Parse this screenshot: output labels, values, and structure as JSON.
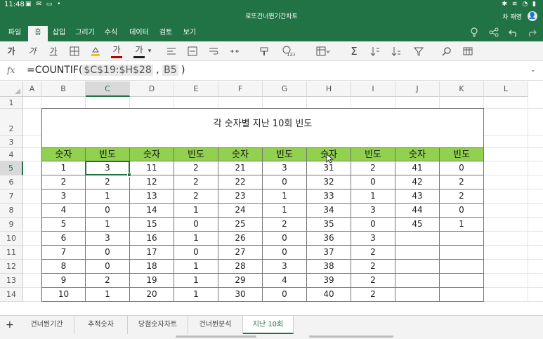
{
  "status": {
    "time": "11:48",
    "icons": "▣ ✉ ▭ •",
    "right": "✱ ≋ ◔ ▮"
  },
  "window": {
    "title": "로또건너뛴기간차트"
  },
  "user": {
    "name": "차 재영",
    "avatar": "👤"
  },
  "ribbon": {
    "tabs": [
      "파일",
      "홈",
      "삽입",
      "그리기",
      "수식",
      "데이터",
      "검토",
      "보기"
    ],
    "active_tab": "홈",
    "right_icons": [
      "lightbulb-icon",
      "share-icon",
      "undo-icon",
      "redo-icon"
    ]
  },
  "toolbar": {
    "bold": "가",
    "italic": "가",
    "underline": "가",
    "font_color": "가",
    "font_color_hex": "#c00000",
    "more_font": "가"
  },
  "formula_bar": {
    "fx": "fx",
    "prefix": "=COUNTIF(",
    "range_ref": "$C$19:$H$28",
    "sep": " , ",
    "cell_ref": "B5",
    "suffix": " )"
  },
  "columns": [
    "A",
    "B",
    "C",
    "D",
    "E",
    "F",
    "G",
    "H",
    "I",
    "J",
    "K",
    "L"
  ],
  "rows": [
    "1",
    "2",
    "3",
    "4",
    "5",
    "6",
    "7",
    "8",
    "9",
    "10",
    "11",
    "12",
    "13",
    "14"
  ],
  "selected_column": "C",
  "selected_row": "5",
  "table": {
    "title": "각 숫자별 지난 10회 빈도",
    "header": [
      "숫자",
      "빈도",
      "숫자",
      "빈도",
      "숫자",
      "빈도",
      "숫자",
      "빈도",
      "숫자",
      "빈도"
    ],
    "rows": [
      [
        "1",
        "3",
        "11",
        "2",
        "21",
        "3",
        "31",
        "2",
        "41",
        "0"
      ],
      [
        "2",
        "2",
        "12",
        "2",
        "22",
        "0",
        "32",
        "0",
        "42",
        "2"
      ],
      [
        "3",
        "1",
        "13",
        "2",
        "23",
        "1",
        "33",
        "1",
        "43",
        "2"
      ],
      [
        "4",
        "0",
        "14",
        "1",
        "24",
        "1",
        "34",
        "3",
        "44",
        "0"
      ],
      [
        "5",
        "1",
        "15",
        "0",
        "25",
        "2",
        "35",
        "0",
        "45",
        "1"
      ],
      [
        "6",
        "3",
        "16",
        "1",
        "26",
        "0",
        "36",
        "3",
        "",
        ""
      ],
      [
        "7",
        "0",
        "17",
        "0",
        "27",
        "0",
        "37",
        "2",
        "",
        ""
      ],
      [
        "8",
        "0",
        "18",
        "1",
        "28",
        "3",
        "38",
        "2",
        "",
        ""
      ],
      [
        "9",
        "2",
        "19",
        "1",
        "29",
        "4",
        "39",
        "2",
        "",
        ""
      ],
      [
        "10",
        "1",
        "20",
        "1",
        "30",
        "0",
        "40",
        "2",
        "",
        ""
      ]
    ]
  },
  "sheets": {
    "add": "+",
    "tabs": [
      "건너뛴기간",
      "추적숫자",
      "당첨숫자차트",
      "건너뛴분석",
      "지난 10회"
    ],
    "active": "지난 10회"
  },
  "colors": {
    "accent": "#217346",
    "header_fill": "#92d050"
  }
}
